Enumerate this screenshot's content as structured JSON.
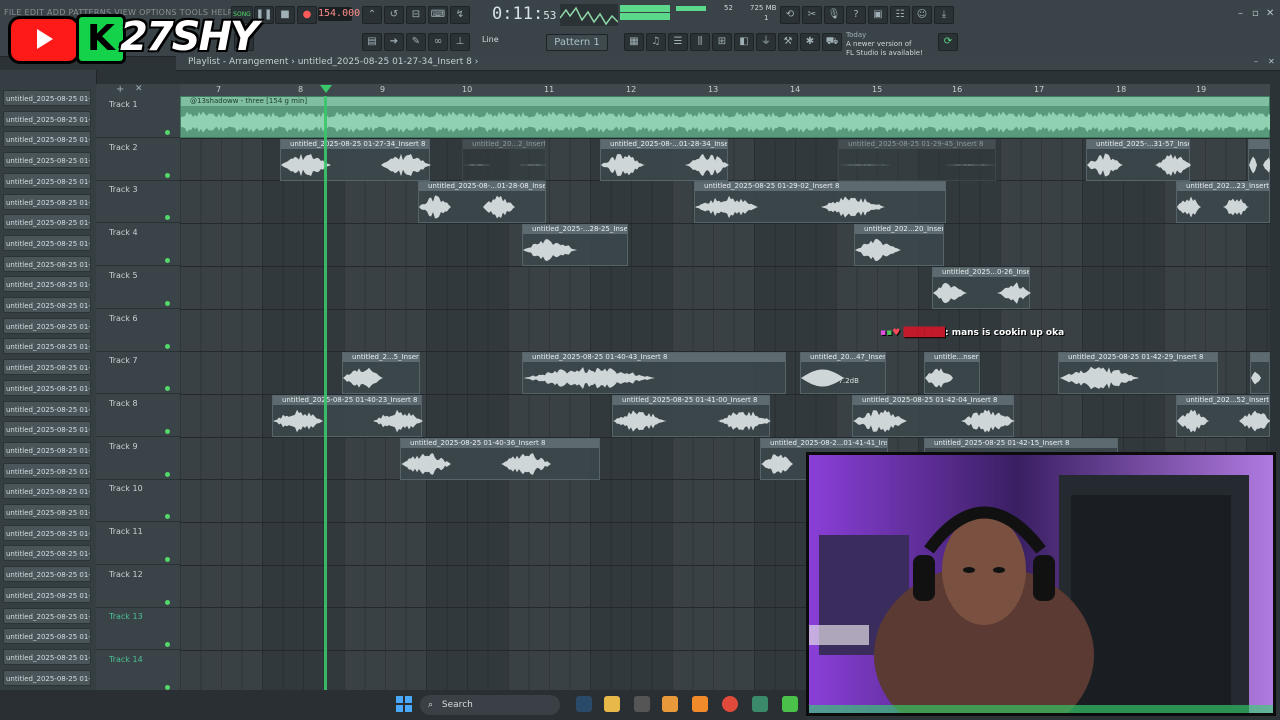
{
  "menu": "FILE  EDIT  ADD  PATTERNS  VIEW  OPTIONS  TOOLS  HELP",
  "overlay": {
    "yt_icon": "youtube-play-icon",
    "k_letter": "K",
    "channel_name": "27SHY"
  },
  "transport": {
    "mode_label": "SONG",
    "tempo": "154.000",
    "time_main": "0:11:",
    "time_small": "53",
    "cpu_value": "52",
    "memory": "725 MB",
    "memory_sub": "1",
    "pattern": "Pattern 1",
    "snap": "Line"
  },
  "news": {
    "day": "Today",
    "line1": "A newer version of",
    "line2": "FL Studio is available!"
  },
  "playlist": {
    "breadcrumb_prefix": "Playlist - Arrangement",
    "breadcrumb_item": "untitled_2025-08-25 01-27-34_Insert 8",
    "ruler": [
      "7",
      "8",
      "9",
      "10",
      "11",
      "12",
      "13",
      "14",
      "15",
      "16",
      "17",
      "18",
      "19"
    ],
    "tracks": [
      "Track 1",
      "Track 2",
      "Track 3",
      "Track 4",
      "Track 5",
      "Track 6",
      "Track 7",
      "Track 8",
      "Track 9",
      "Track 10",
      "Track 11",
      "Track 12",
      "Track 13",
      "Track 14"
    ]
  },
  "browser_item": "untitled_2025-08-25 01-...",
  "clips": {
    "t1": "@13shadoww - three [154 g min]",
    "t2a": "untitled_2025-08-25 01-27-34_Insert 8",
    "t2b": "untitled_20...2_Insert 8",
    "t2c": "untitled_2025-08-...01-28-34_Insert 8",
    "t2d": "untitled_2025-08-25 01-29-45_Insert 8",
    "t2e": "untitled_2025-...31-57_Insert 8",
    "t3a": "untitled_2025-08-...01-28-08_Insert 8",
    "t3b": "untitled_2025-08-25 01-29-02_Insert 8",
    "t3c": "untitled_202...23_Insert 8",
    "t4a": "untitled_2025-...28-25_Insert 8",
    "t4b": "untitled_202...20_Insert 8",
    "t5a": "untitled_2025...0-26_Insert 8",
    "t7a": "untitled_2...5_Insert 8",
    "t7b": "untitled_2025-08-25 01-40-43_Insert 8",
    "t7c": "untitled_20...47_Insert 8",
    "t7d": "untitle...nsert 8",
    "t7e": "untitled_2025-08-25 01-42-29_Insert 8",
    "t8a": "untitled_2025-08-25 01-40-23_Insert 8",
    "t8b": "untitled_2025-08-25 01-41-00_Insert 8",
    "t8c": "untitled_2025-08-25 01-42-04_Insert 8",
    "t8d": "untitled_202...52_Insert 8",
    "t9a": "untitled_2025-08-25 01-40-36_Insert 8",
    "t9b": "untitled_2025-08-2...01-41-41_Insert 8",
    "t9c": "untitled_2025-08-25 01-42-15_Insert 8"
  },
  "volume_hint": "-7.2dB",
  "chat": {
    "message": ": mans is cookin up oka"
  },
  "taskbar": {
    "search": "Search"
  }
}
